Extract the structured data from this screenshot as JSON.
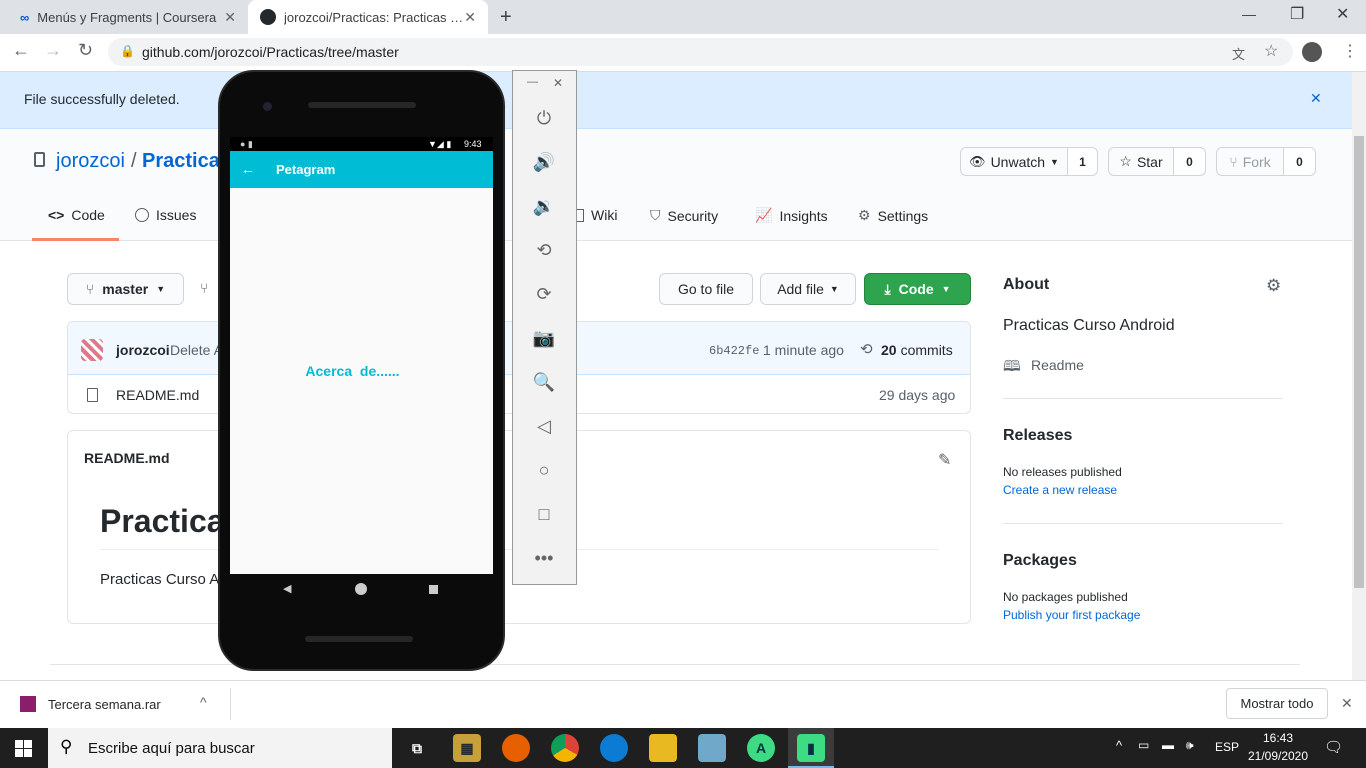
{
  "browser": {
    "tabs": [
      {
        "title": "Menús y Fragments | Coursera"
      },
      {
        "title": "jorozcoi/Practicas: Practicas Curso"
      }
    ],
    "url": "github.com/jorozcoi/Practicas/tree/master"
  },
  "banner": {
    "message": "File successfully deleted."
  },
  "repo": {
    "owner": "jorozcoi",
    "sep": "/",
    "name": "Practicas",
    "watch": {
      "label": "Unwatch",
      "count": "1"
    },
    "star": {
      "label": "Star",
      "count": "0"
    },
    "fork": {
      "label": "Fork",
      "count": "0"
    },
    "tabs": [
      "Code",
      "Issues",
      "Wiki",
      "Security",
      "Insights",
      "Settings"
    ]
  },
  "toolbar": {
    "branch": "master",
    "goto": "Go to file",
    "add": "Add file",
    "code": "Code"
  },
  "commit": {
    "author": "jorozcoi",
    "message": "Delete A",
    "sha": "6b422fe",
    "time": "1 minute ago",
    "commits_count": "20",
    "commits_label": "commits"
  },
  "files": [
    {
      "name": "README.md",
      "age": "29 days ago"
    }
  ],
  "readme": {
    "header": "README.md",
    "title": "Practicas",
    "body": "Practicas Curso A"
  },
  "about": {
    "heading": "About",
    "description": "Practicas Curso Android",
    "readme": "Readme"
  },
  "releases": {
    "heading": "Releases",
    "none": "No releases published",
    "link": "Create a new release"
  },
  "packages": {
    "heading": "Packages",
    "none": "No packages published",
    "link": "Publish your first package"
  },
  "phone": {
    "time": "9:43",
    "app_title": "Petagram",
    "content": "Acerca  de......",
    "accent": "#00bcd4"
  },
  "download": {
    "file": "Tercera semana.rar",
    "show_all": "Mostrar todo"
  },
  "taskbar": {
    "search_placeholder": "Escribe aquí para buscar",
    "lang": "ESP",
    "time": "16:43",
    "date": "21/09/2020"
  }
}
